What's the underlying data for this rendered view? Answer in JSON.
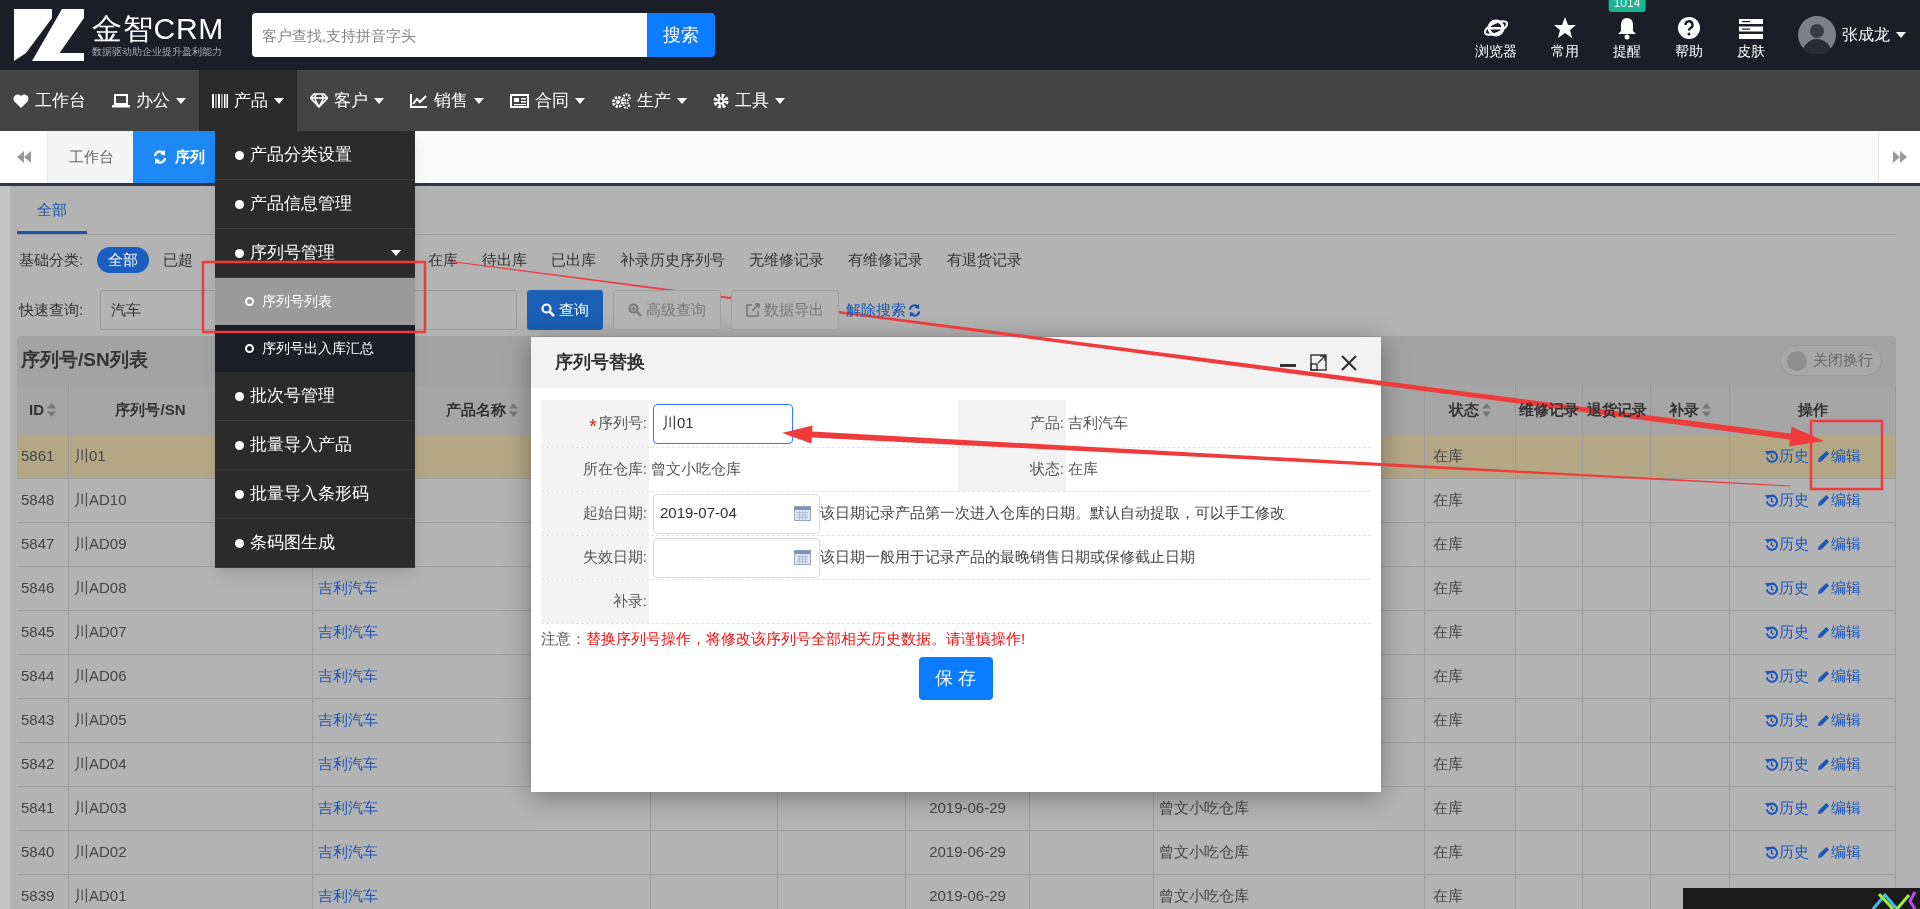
{
  "header": {
    "logo_text": "金智CRM",
    "tagline": "数据驱动助企业提升盈利能力",
    "search": {
      "placeholder": "客户查找,支持拼音字头",
      "button": "搜索"
    },
    "tools": [
      {
        "label": "浏览器",
        "kind": "browser"
      },
      {
        "label": "常用",
        "kind": "star"
      },
      {
        "label": "提醒",
        "kind": "bell",
        "badge": "1014"
      },
      {
        "label": "帮助",
        "kind": "help"
      },
      {
        "label": "皮肤",
        "kind": "skin"
      }
    ],
    "user": {
      "name": "张成龙"
    }
  },
  "nav": [
    {
      "label": "工作台",
      "kind": "heart",
      "has_menu": false,
      "selected": false
    },
    {
      "label": "办公",
      "kind": "laptop",
      "has_menu": true,
      "selected": false
    },
    {
      "label": "产品",
      "kind": "barcode",
      "has_menu": true,
      "selected": true
    },
    {
      "label": "客户",
      "kind": "diamond",
      "has_menu": true,
      "selected": false
    },
    {
      "label": "销售",
      "kind": "chart",
      "has_menu": true,
      "selected": false
    },
    {
      "label": "合同",
      "kind": "newspaper",
      "has_menu": true,
      "selected": false
    },
    {
      "label": "生产",
      "kind": "cogs",
      "has_menu": true,
      "selected": false
    },
    {
      "label": "工具",
      "kind": "gear",
      "has_menu": true,
      "selected": false
    }
  ],
  "dropdown": [
    {
      "label": "产品分类设置"
    },
    {
      "label": "产品信息管理"
    },
    {
      "label": "序列号管理",
      "expanded": true,
      "children": [
        {
          "label": "序列号列表",
          "selected": true
        },
        {
          "label": "序列号出入库汇总",
          "selected": false
        }
      ]
    },
    {
      "label": "批次号管理"
    },
    {
      "label": "批量导入产品"
    },
    {
      "label": "批量导入条形码"
    },
    {
      "label": "条码图生成"
    }
  ],
  "tabs": [
    {
      "label": "工作台",
      "selected": false
    },
    {
      "label": "序列",
      "selected": true
    }
  ],
  "filter": {
    "tabs": [
      {
        "label": "全部",
        "selected": true
      }
    ],
    "category_label": "基础分类:",
    "categories": [
      {
        "label": "全部",
        "selected": true
      },
      {
        "label": "已超",
        "selected": false
      },
      {
        "label": "在库",
        "selected": false
      },
      {
        "label": "待出库",
        "selected": false
      },
      {
        "label": "已出库",
        "selected": false
      },
      {
        "label": "补录历史序列号",
        "selected": false
      },
      {
        "label": "无维修记录",
        "selected": false
      },
      {
        "label": "有维修记录",
        "selected": false
      },
      {
        "label": "有退货记录",
        "selected": false
      }
    ],
    "quick_search": {
      "label": "快速查询:",
      "value": "汽车"
    },
    "buttons": [
      {
        "label": "查询",
        "kind": "search"
      },
      {
        "label": "高级查询",
        "kind": "advanced"
      },
      {
        "label": "数据导出",
        "kind": "export"
      },
      {
        "label": "解除搜索",
        "kind": "link"
      }
    ]
  },
  "table": {
    "title": "序列号/SN列表",
    "wrap_toggle": {
      "label": "关闭换行",
      "on": false
    },
    "columns": [
      {
        "label": "ID",
        "sortable": true
      },
      {
        "label": "序列号/SN",
        "sortable": false
      },
      {
        "label": "产品名称",
        "sortable": true
      },
      {
        "label": "状态",
        "sortable": true
      },
      {
        "label": "维修记录",
        "sortable": false
      },
      {
        "label": "退货记录",
        "sortable": false
      },
      {
        "label": "补录",
        "sortable": true
      },
      {
        "label": "操作",
        "sortable": false
      }
    ],
    "rows": [
      {
        "id": "5861",
        "sn": "川01",
        "status": "在库",
        "selected": true,
        "actions": [
          {
            "label": "历史",
            "kind": "history"
          },
          {
            "label": "编辑",
            "kind": "edit"
          }
        ]
      },
      {
        "id": "5848",
        "sn": "川AD10",
        "status": "在库",
        "selected": false,
        "actions": [
          {
            "label": "历史",
            "kind": "history"
          },
          {
            "label": "编辑",
            "kind": "edit"
          }
        ]
      },
      {
        "id": "5847",
        "sn": "川AD09",
        "status": "在库",
        "selected": false,
        "actions": [
          {
            "label": "历史",
            "kind": "history"
          },
          {
            "label": "编辑",
            "kind": "edit"
          }
        ]
      },
      {
        "id": "5846",
        "sn": "川AD08",
        "product": "吉利汽车",
        "status": "在库",
        "selected": false,
        "actions": [
          {
            "label": "历史",
            "kind": "history"
          },
          {
            "label": "编辑",
            "kind": "edit"
          }
        ]
      },
      {
        "id": "5845",
        "sn": "川AD07",
        "product": "吉利汽车",
        "status": "在库",
        "selected": false,
        "actions": [
          {
            "label": "历史",
            "kind": "history"
          },
          {
            "label": "编辑",
            "kind": "edit"
          }
        ]
      },
      {
        "id": "5844",
        "sn": "川AD06",
        "product": "吉利汽车",
        "status": "在库",
        "selected": false,
        "actions": [
          {
            "label": "历史",
            "kind": "history"
          },
          {
            "label": "编辑",
            "kind": "edit"
          }
        ]
      },
      {
        "id": "5843",
        "sn": "川AD05",
        "product": "吉利汽车",
        "status": "在库",
        "selected": false,
        "actions": [
          {
            "label": "历史",
            "kind": "history"
          },
          {
            "label": "编辑",
            "kind": "edit"
          }
        ]
      },
      {
        "id": "5842",
        "sn": "川AD04",
        "product": "吉利汽车",
        "status": "在库",
        "selected": false,
        "actions": [
          {
            "label": "历史",
            "kind": "history"
          },
          {
            "label": "编辑",
            "kind": "edit"
          }
        ]
      },
      {
        "id": "5841",
        "sn": "川AD03",
        "product": "吉利汽车",
        "column_6": "2019-06-29",
        "column_8": "曾文小吃仓库",
        "status": "在库",
        "selected": false,
        "actions": [
          {
            "label": "历史",
            "kind": "history"
          },
          {
            "label": "编辑",
            "kind": "edit"
          }
        ]
      },
      {
        "id": "5840",
        "sn": "川AD02",
        "product": "吉利汽车",
        "column_6": "2019-06-29",
        "column_8": "曾文小吃仓库",
        "status": "在库",
        "selected": false,
        "actions": [
          {
            "label": "历史",
            "kind": "history"
          },
          {
            "label": "编辑",
            "kind": "edit"
          }
        ]
      },
      {
        "id": "5839",
        "sn": "川AD01",
        "product": "吉利汽车",
        "column_6": "2019-06-29",
        "column_8": "曾文小吃仓库",
        "status": "在库",
        "selected": false
      }
    ]
  },
  "modal": {
    "title": "序列号替换",
    "rows": [
      {
        "fields": [
          {
            "label": "序列号:",
            "marker": "*",
            "kind": "input",
            "value": "川01",
            "focused": true
          },
          {
            "label": "产品:",
            "kind": "text",
            "value": "吉利汽车"
          }
        ]
      },
      {
        "fields": [
          {
            "label": "所在仓库:",
            "kind": "text",
            "value": "曾文小吃仓库"
          },
          {
            "label": "状态:",
            "kind": "text",
            "value": "在库"
          }
        ]
      },
      {
        "fields": [
          {
            "label": "起始日期:",
            "kind": "date",
            "value": "2019-07-04",
            "focused": false,
            "hint": "该日期记录产品第一次进入仓库的日期。默认自动提取，可以手工修改"
          }
        ]
      },
      {
        "fields": [
          {
            "label": "失效日期:",
            "kind": "date",
            "focused": false,
            "hint": "该日期一般用于记录产品的最晚销售日期或保修截止日期"
          }
        ]
      },
      {
        "fields": [
          {
            "label": "补录:",
            "kind": "text"
          }
        ]
      }
    ],
    "note": {
      "label": "注意：",
      "text": "替换序列号操作，将修改该序列号全部相关历史数据。请谨慎操作!"
    },
    "save_button": "保 存"
  }
}
